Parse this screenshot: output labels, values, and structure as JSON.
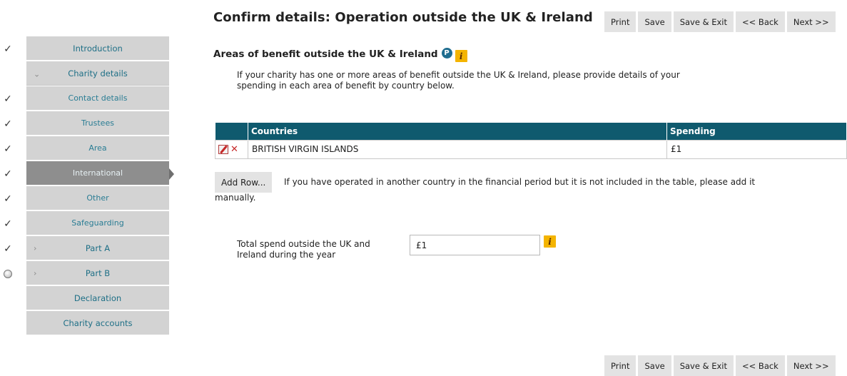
{
  "header": {
    "title": "Confirm details: Operation outside the UK & Ireland"
  },
  "toolbar": {
    "print": "Print",
    "save": "Save",
    "save_exit": "Save & Exit",
    "back": "<< Back",
    "next": "Next >>"
  },
  "sidebar": {
    "items": [
      {
        "label": "Introduction",
        "status": "✓"
      },
      {
        "label": "Charity details",
        "status": "",
        "chevron": "⌄"
      },
      {
        "label": "Contact details",
        "status": "✓"
      },
      {
        "label": "Trustees",
        "status": "✓"
      },
      {
        "label": "Area",
        "status": "✓"
      },
      {
        "label": "International",
        "status": "✓"
      },
      {
        "label": "Other",
        "status": "✓"
      },
      {
        "label": "Safeguarding",
        "status": "✓"
      },
      {
        "label": "Part A",
        "status": "✓",
        "chevron": "›"
      },
      {
        "label": "Part B",
        "status": "pending",
        "chevron": "›"
      },
      {
        "label": "Declaration",
        "status": ""
      },
      {
        "label": "Charity accounts",
        "status": ""
      }
    ]
  },
  "section": {
    "title": "Areas of benefit outside the UK & Ireland",
    "p_icon": "P",
    "info_icon": "i",
    "intro": "If your charity has one or more areas of benefit outside the UK & Ireland, please provide details of your spending in each area of benefit by country below."
  },
  "table": {
    "columns": [
      "",
      "Countries",
      "Spending"
    ],
    "rows": [
      {
        "country": "BRITISH VIRGIN ISLANDS",
        "spending": "£1"
      }
    ]
  },
  "add_row": {
    "label": "Add Row...",
    "note_line1": "If you have operated in another country in the financial period but it is not included in the table, please add it",
    "note_line2": "manually."
  },
  "total": {
    "label": "Total spend outside the UK and Ireland during the year",
    "value": "£1",
    "info_icon": "i"
  },
  "colors": {
    "accent": "#0f5a6e",
    "nav_bg": "#d3d3d3",
    "nav_active": "#8e8e8e",
    "nav_text": "#1e6f86",
    "info": "#f4b400"
  },
  "icons": {
    "status_done": "check-icon",
    "status_pending": "pending-circle-icon",
    "edit": "edit-pencil-icon",
    "delete": "delete-x-icon"
  }
}
